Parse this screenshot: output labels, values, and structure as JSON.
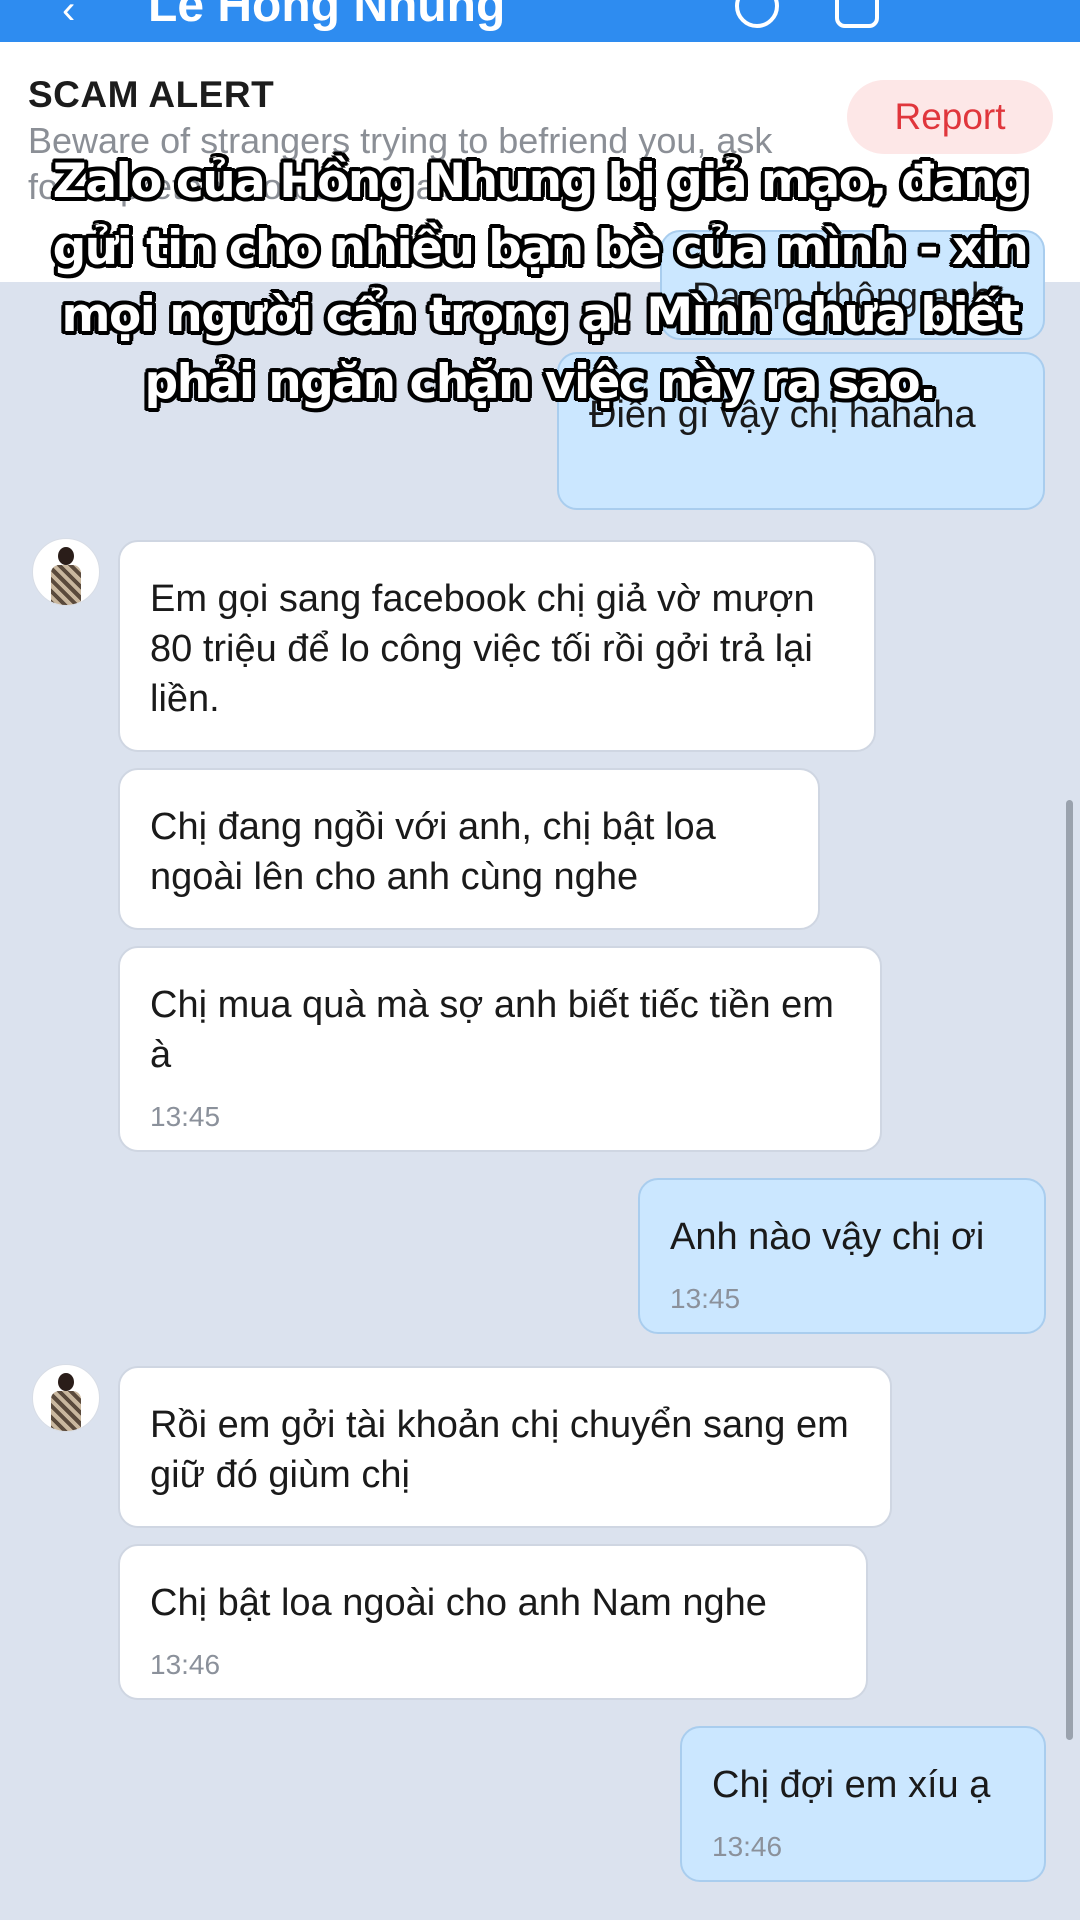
{
  "header": {
    "back_icon": "‹",
    "title": "Lê Hồng Nhung",
    "icons": [
      "call-icon",
      "video-call-icon",
      "menu-icon"
    ]
  },
  "scam_alert": {
    "heading": "SCAM ALERT",
    "body": "Beware of strangers trying to befriend you, ask for ... pretend to be officials",
    "report_label": "Report"
  },
  "caption": "Zalo của Hồng Nhung bị giả mạo, đang gửi tin cho nhiều bạn bè của mình - xin mọi người cẩn trọng ạ! Mình chưa biết phải ngăn chặn việc này ra sao.",
  "messages": [
    {
      "side": "mine",
      "text": "Dạ em không anh"
    },
    {
      "side": "mine",
      "text": "Điền gì vậy chị hahaha"
    },
    {
      "side": "theirs",
      "text": "Em gọi sang facebook chị giả vờ mượn 80 triệu để lo công việc tối rồi gởi trả lại liền."
    },
    {
      "side": "theirs",
      "text": "Chị đang ngồi với anh, chị bật loa ngoài lên cho anh cùng nghe"
    },
    {
      "side": "theirs",
      "text": "Chị mua quà mà sợ anh biết tiếc tiền em à",
      "time": "13:45"
    },
    {
      "side": "mine",
      "text": "Anh nào vậy chị ơi",
      "time": "13:45"
    },
    {
      "side": "theirs",
      "text": "Rồi em gởi tài khoản chị chuyển sang em giữ đó giùm chị"
    },
    {
      "side": "theirs",
      "text": "Chị bật loa ngoài cho anh Nam nghe",
      "time": "13:46"
    },
    {
      "side": "mine",
      "text": "Chị đợi em xíu ạ",
      "time": "13:46"
    }
  ]
}
